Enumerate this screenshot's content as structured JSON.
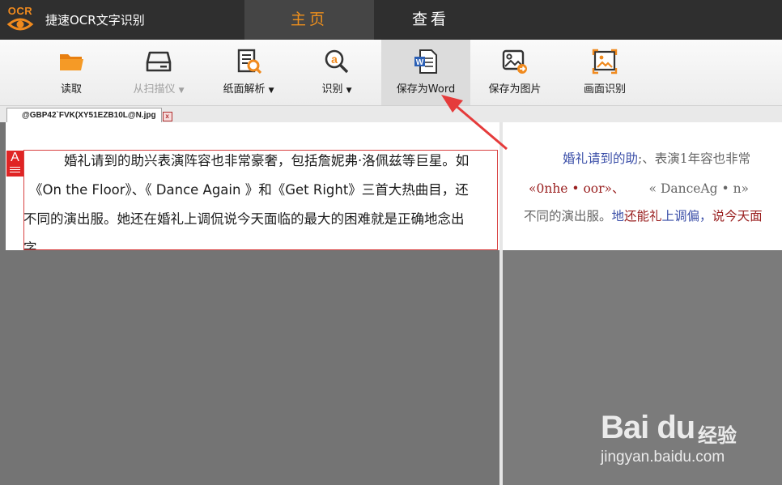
{
  "app": {
    "logo_text": "OCR",
    "title": "捷速OCR文字识别",
    "accent": "#f0901c"
  },
  "tabs": [
    {
      "label": "主页",
      "active": true
    },
    {
      "label": "查看",
      "active": false
    }
  ],
  "toolbar": {
    "read": "读取",
    "scanner": "从扫描仪",
    "page_analysis": "纸面解析",
    "recognize": "识别",
    "save_word": "保存为Word",
    "save_image": "保存为图片",
    "screen_recognize": "画面识别"
  },
  "document": {
    "filename": "@GBP42`FVK(XY51EZB10L@N.jpg",
    "close_glyph": "x"
  },
  "original_text": {
    "marker": "A",
    "line1": "婚礼请到的助兴表演阵容也非常豪奢，包括詹妮弗·洛佩兹等巨星。如",
    "line2": "《On the Floor》、《 Dance Again 》和《Get Right》三首大热曲目，还",
    "line3": "不同的演出服。她还在婚礼上调侃说今天面临的最大的困难就是正确地念出",
    "line4": "字。"
  },
  "ocr_text": {
    "l1a": "婚礼",
    "l1b": "请到的助",
    "l1c": ";、表演1年容也非常",
    "l2a": "«0nhe • oor»、",
    "l2b": "« DanceAg • n»",
    "l3a": "不同的演出服。",
    "l3b": "地",
    "l3c": "还能礼",
    "l3d": "上调偏，",
    "l3e": "说今天面"
  },
  "watermark": {
    "brand": "Bai du",
    "sub": "经验",
    "url": "jingyan.baidu.com"
  }
}
